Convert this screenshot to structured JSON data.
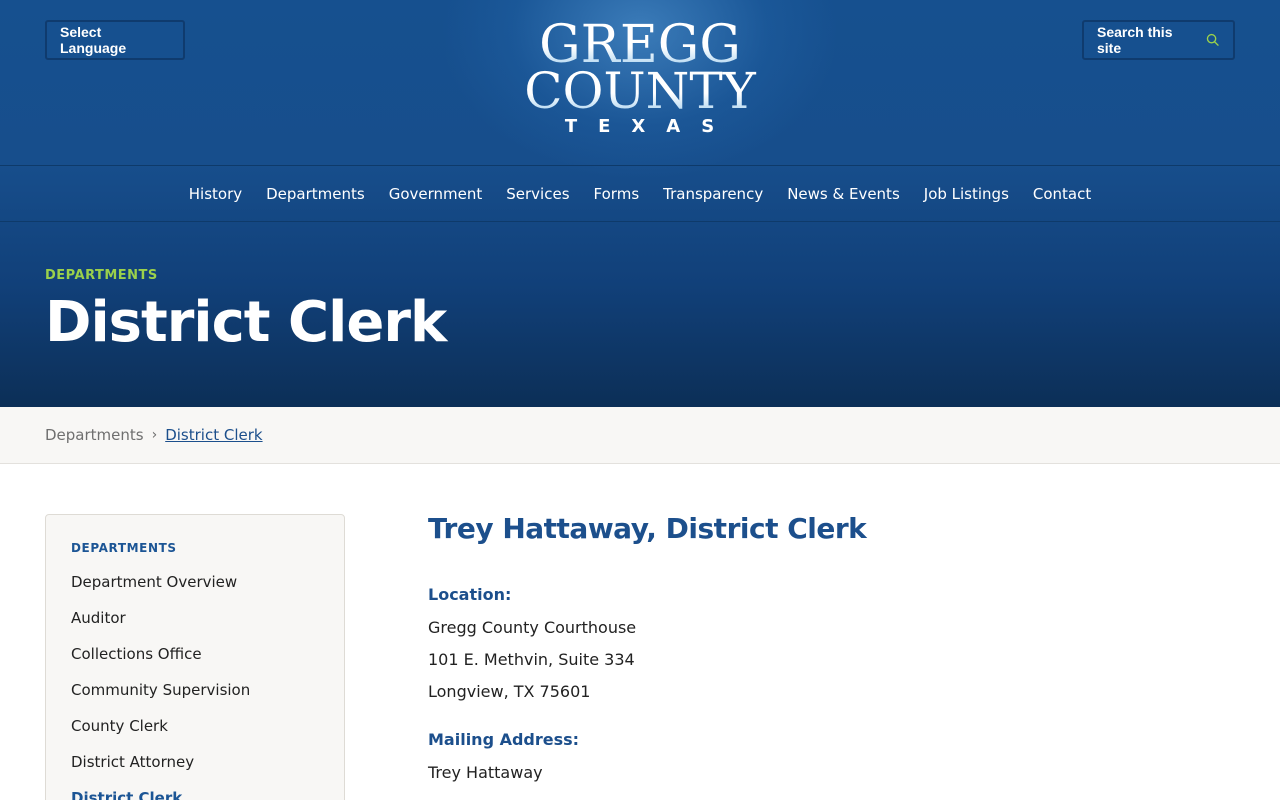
{
  "header": {
    "language_button": "Select Language",
    "search_button": "Search this site",
    "logo": {
      "line1": "GREGG",
      "line2": "COUNTY",
      "line3": "TEXAS"
    },
    "nav": [
      "History",
      "Departments",
      "Government",
      "Services",
      "Forms",
      "Transparency",
      "News & Events",
      "Job Listings",
      "Contact"
    ],
    "eyebrow": "DEPARTMENTS",
    "title": "District Clerk"
  },
  "breadcrumb": {
    "parent": "Departments",
    "current": "District Clerk"
  },
  "sidebar": {
    "heading": "DEPARTMENTS",
    "items": [
      "Department Overview",
      "Auditor",
      "Collections Office",
      "Community Supervision",
      "County Clerk",
      "District Attorney",
      "District Clerk"
    ]
  },
  "main": {
    "heading": "Trey Hattaway, District Clerk",
    "location_label": "Location:",
    "location_lines": [
      "Gregg County Courthouse",
      "101 E. Methvin, Suite 334",
      "Longview, TX 75601"
    ],
    "mailing_label": "Mailing Address:",
    "mailing_lines": [
      "Trey Hattaway"
    ]
  },
  "colors": {
    "header_blue": "#16508f",
    "accent_green": "#9bd14b",
    "link_blue": "#1c4f8c"
  }
}
